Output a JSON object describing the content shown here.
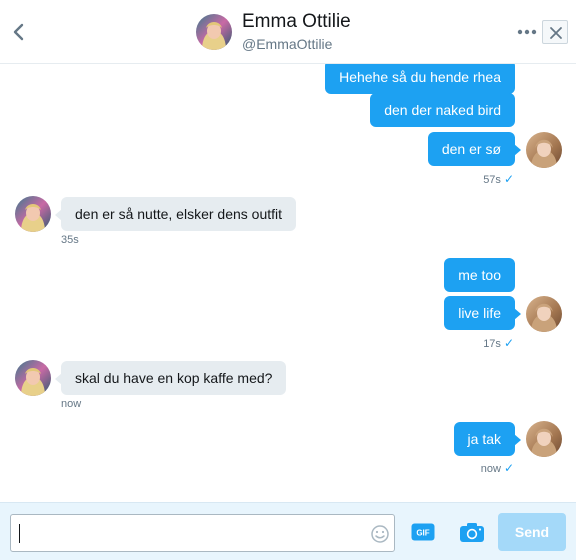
{
  "header": {
    "name": "Emma Ottilie",
    "handle": "@EmmaOttilie",
    "back_icon": "chevron-left-icon",
    "more_icon": "more-dots-icon",
    "close_icon": "close-icon"
  },
  "messages": [
    {
      "direction": "sent",
      "text": "Hehehe så du hende rhea"
    },
    {
      "direction": "sent",
      "text": "den der naked bird"
    },
    {
      "direction": "sent",
      "text": "den er sø",
      "time": "57s",
      "read": true
    },
    {
      "direction": "received",
      "text": "den er så nutte, elsker dens outfit",
      "time": "35s"
    },
    {
      "direction": "sent",
      "text": "me too"
    },
    {
      "direction": "sent",
      "text": "live life",
      "time": "17s",
      "read": true
    },
    {
      "direction": "received",
      "text": "skal du have en kop kaffe med?",
      "time": "now"
    },
    {
      "direction": "sent",
      "text": "ja tak",
      "time": "now",
      "read": true
    }
  ],
  "read_mark": "✓",
  "composer": {
    "input_value": "",
    "emoji_icon": "emoji-icon",
    "gif_icon": "gif-icon",
    "gif_label": "GIF",
    "camera_icon": "camera-icon",
    "send_label": "Send"
  },
  "colors": {
    "accent": "#1da1f2",
    "received_bubble": "#e6ecf0",
    "send_disabled": "#a4d9f9",
    "composer_bg": "#e8f5fd"
  }
}
